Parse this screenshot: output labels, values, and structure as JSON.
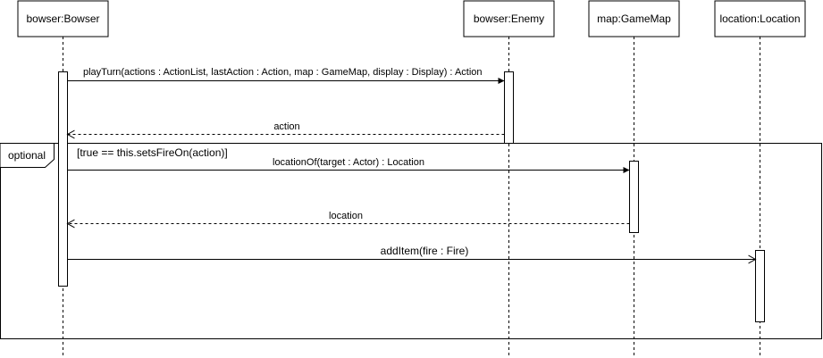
{
  "lifelines": [
    {
      "id": "bowser",
      "label": "bowser:Bowser"
    },
    {
      "id": "enemy",
      "label": "bowser:Enemy"
    },
    {
      "id": "map",
      "label": "map:GameMap"
    },
    {
      "id": "location",
      "label": "location:Location"
    }
  ],
  "messages": [
    {
      "id": "play-turn",
      "from": "bowser",
      "to": "enemy",
      "kind": "sync",
      "label": "playTurn(actions : ActionList, lastAction : Action, map : GameMap, display : Display) : Action"
    },
    {
      "id": "action-return",
      "from": "enemy",
      "to": "bowser",
      "kind": "return",
      "label": "action"
    },
    {
      "id": "location-of",
      "from": "bowser",
      "to": "map",
      "kind": "sync",
      "label": "locationOf(target : Actor) : Location"
    },
    {
      "id": "location-return",
      "from": "map",
      "to": "bowser",
      "kind": "return",
      "label": "location"
    },
    {
      "id": "add-item",
      "from": "bowser",
      "to": "location",
      "kind": "async",
      "label": "addItem(fire : Fire)"
    }
  ],
  "fragment": {
    "operator": "optional",
    "guard": "[true == this.setsFireOn(action)]"
  },
  "colors": {
    "line": "#000000",
    "lifeline": "#000000",
    "background": "#ffffff"
  }
}
